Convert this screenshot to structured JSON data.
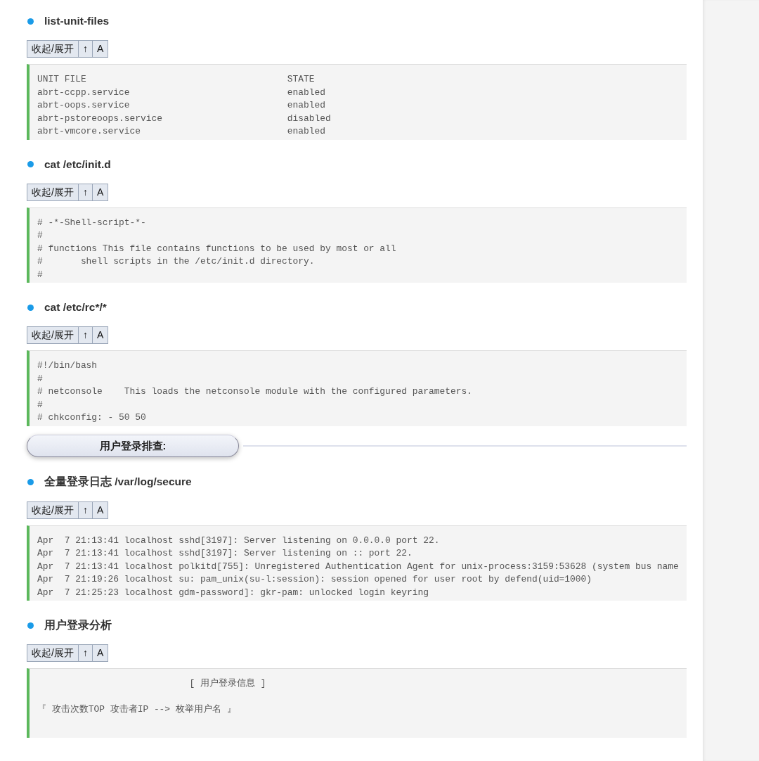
{
  "sections": [
    {
      "kind": "command",
      "title": "list-unit-files",
      "toolbar": [
        "收起/展开",
        "↑",
        "A"
      ],
      "code": "UNIT FILE                                     STATE\nabrt-ccpp.service                             enabled\nabrt-oops.service                             enabled\nabrt-pstoreoops.service                       disabled\nabrt-vmcore.service                           enabled"
    },
    {
      "kind": "command",
      "title": "cat /etc/init.d",
      "toolbar": [
        "收起/展开",
        "↑",
        "A"
      ],
      "code": "# -*-Shell-script-*-\n#\n# functions This file contains functions to be used by most or all\n#       shell scripts in the /etc/init.d directory.\n#"
    },
    {
      "kind": "command",
      "title": "cat /etc/rc*/*",
      "toolbar": [
        "收起/展开",
        "↑",
        "A"
      ],
      "code": "#!/bin/bash\n#\n# netconsole    This loads the netconsole module with the configured parameters.\n#\n# chkconfig: - 50 50"
    },
    {
      "kind": "banner",
      "title": "用户登录排查:"
    },
    {
      "kind": "command",
      "title": "全量登录日志 /var/log/secure",
      "toolbar": [
        "收起/展开",
        "↑",
        "A"
      ],
      "code": "Apr  7 21:13:41 localhost sshd[3197]: Server listening on 0.0.0.0 port 22.\nApr  7 21:13:41 localhost sshd[3197]: Server listening on :: port 22.\nApr  7 21:13:41 localhost polkitd[755]: Unregistered Authentication Agent for unix-process:3159:53628 (system bus name\nApr  7 21:19:26 localhost su: pam_unix(su-l:session): session opened for user root by defend(uid=1000)\nApr  7 21:25:23 localhost gdm-password]: gkr-pam: unlocked login keyring"
    },
    {
      "kind": "command",
      "title": "用户登录分析",
      "toolbar": [
        "收起/展开",
        "↑",
        "A"
      ],
      "code": "                            [ 用户登录信息 ]\n\n『 攻击次数TOP 攻击者IP --> 枚举用户名 』"
    }
  ]
}
